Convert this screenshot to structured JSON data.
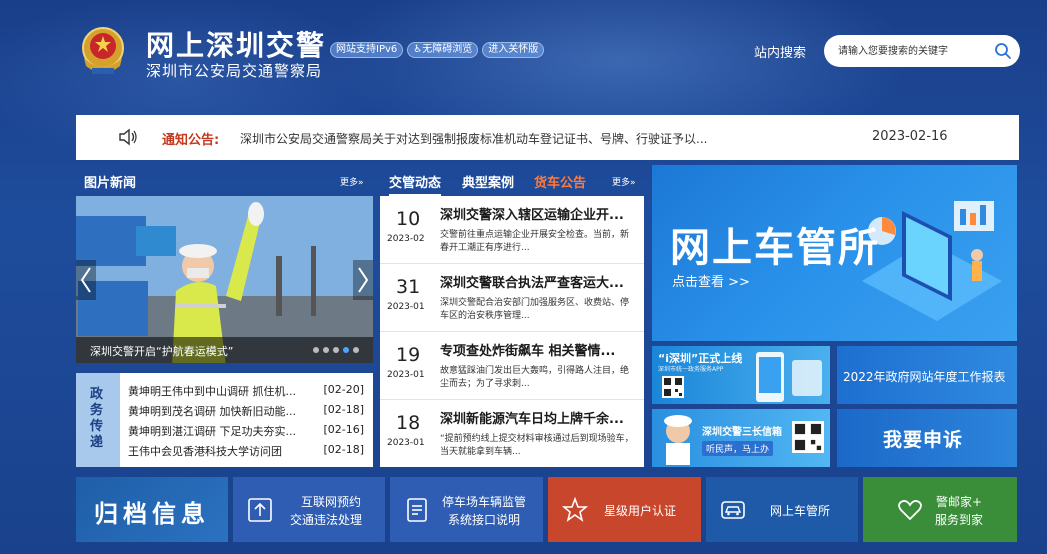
{
  "header": {
    "title": "网上深圳交警",
    "subtitle": "深圳市公安局交通警察局",
    "badges": [
      "网站支持IPv6",
      "♿无障碍浏览",
      "进入关怀版"
    ],
    "search_label": "站内搜索",
    "search_placeholder": "请输入您要搜索的关键字"
  },
  "notice": {
    "label": "通知公告:",
    "text": "深圳市公安局交通警察局关于对达到强制报废标准机动车登记证书、号牌、行驶证予以...",
    "date": "2023-02-16"
  },
  "picture_news": {
    "title": "图片新闻",
    "more": "更多»",
    "caption": "深圳交警开启“护航春运模式”",
    "slide_count": 5,
    "active_slide": 3
  },
  "politics": {
    "label": "政务传递",
    "items": [
      {
        "title": "黄坤明王伟中到中山调研 抓住机...",
        "date": "[02-20]"
      },
      {
        "title": "黄坤明到茂名调研 加快新旧动能...",
        "date": "[02-18]"
      },
      {
        "title": "黄坤明到湛江调研 下足功夫夯实...",
        "date": "[02-16]"
      },
      {
        "title": "王伟中会见香港科技大学访问团",
        "date": "[02-18]"
      }
    ]
  },
  "traffic": {
    "tabs": [
      {
        "label": "交管动态",
        "active": true
      },
      {
        "label": "典型案例",
        "active": false
      },
      {
        "label": "货车公告",
        "active": false
      }
    ],
    "more": "更多»",
    "items": [
      {
        "day": "10",
        "ym": "2023-02",
        "title": "深圳交警深入辖区运输企业开...",
        "desc": "交警前往重点运输企业开展安全检查。当前，新春开工潮正有序进行..."
      },
      {
        "day": "31",
        "ym": "2023-01",
        "title": "深圳交警联合执法严查客运大...",
        "desc": "深圳交警配合治安部门加强服务区、收费站、停车区的治安秩序管理..."
      },
      {
        "day": "19",
        "ym": "2023-01",
        "title": "专项查处炸街飙车 相关警情...",
        "desc": "故意猛踩油门发出巨大轰鸣，引得路人注目，绝尘而去；为了寻求刺..."
      },
      {
        "day": "18",
        "ym": "2023-01",
        "title": "深圳新能源汽车日均上牌千余...",
        "desc": "“提前预约线上提交材料审核通过后到现场验车，当天就能拿到车辆..."
      }
    ]
  },
  "promos": {
    "main_title": "网上车管所",
    "main_sub": "点击查看 >>",
    "tile1_title": "“i深圳”正式上线",
    "tile1_sub": "深圳市统一政务服务APP",
    "tile2_text": "2022年政府网站年度工作报表",
    "tile3_title": "深圳交警三长信箱",
    "tile3_sub": "听民声，马上办",
    "tile4_text": "我要申诉"
  },
  "bottom": {
    "archive": "归档信息",
    "btn1_l1": "互联网预约",
    "btn1_l2": "交通违法处理",
    "btn2_l1": "停车场车辆监管",
    "btn2_l2": "系统接口说明",
    "btn3": "星级用户认证",
    "btn4": "网上车管所",
    "btn5_l1": "警邮家+",
    "btn5_l2": "服务到家"
  },
  "colors": {
    "accent_red": "#c43a1e",
    "btn_blue": "#2f5db3",
    "btn_red": "#c8462c",
    "btn_navy": "#1f5aa8",
    "btn_green": "#3a8e3a"
  }
}
